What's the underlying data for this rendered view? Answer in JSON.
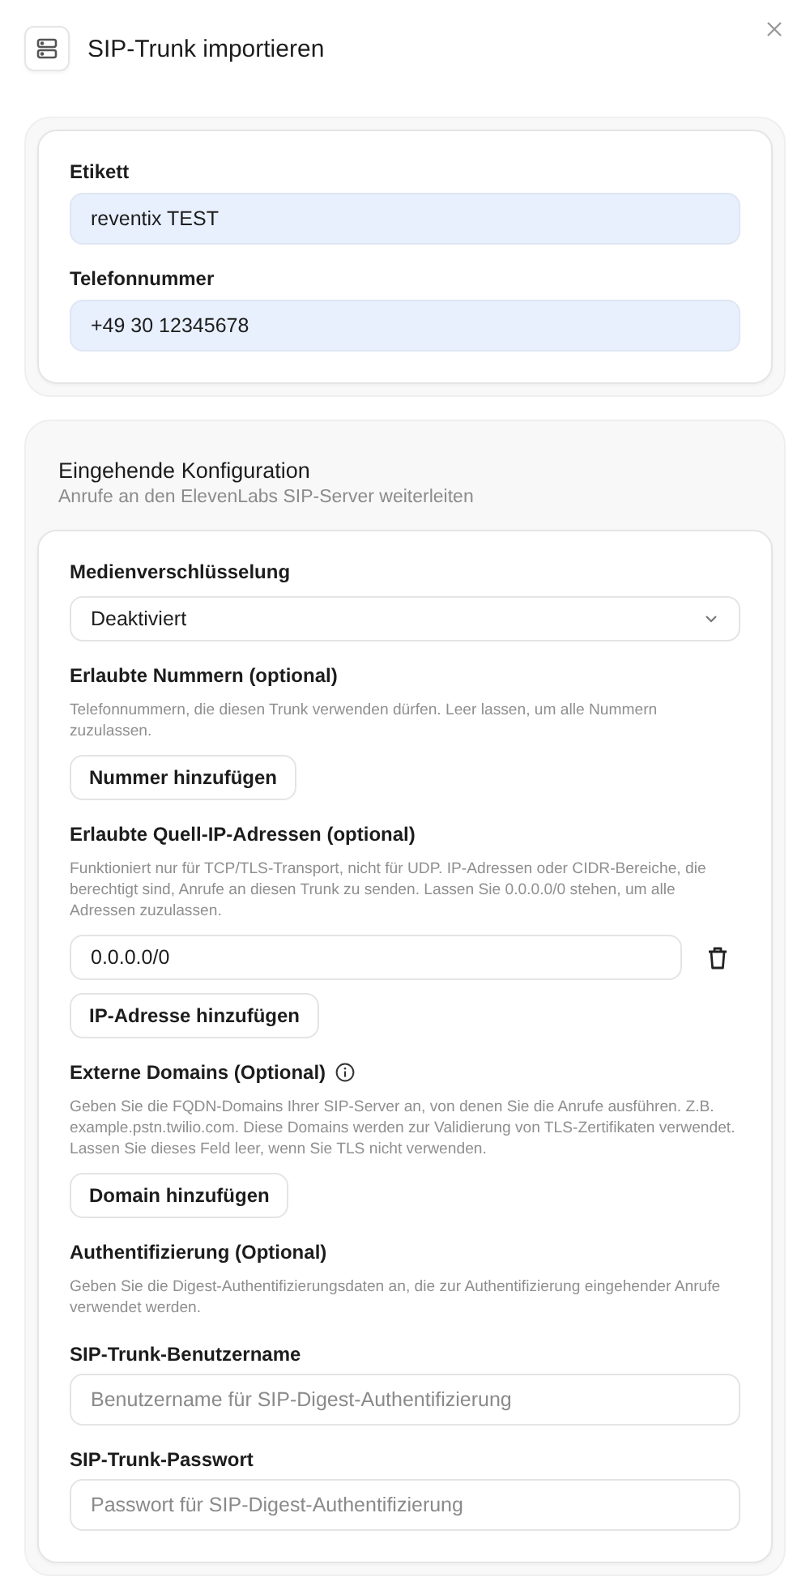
{
  "dialog": {
    "title": "SIP-Trunk importieren"
  },
  "basic_fields": [
    {
      "label": "Etikett",
      "value": "reventix TEST",
      "autofilled": true
    },
    {
      "label": "Telefonnummer",
      "value": "+49 30 12345678",
      "autofilled": true
    }
  ],
  "inbound": {
    "title": "Eingehende Konfiguration",
    "subtitle": "Anrufe an den ElevenLabs SIP-Server weiterleiten",
    "items": [
      {
        "kind": "select",
        "label": "Medienverschlüsselung",
        "value": "Deaktiviert"
      },
      {
        "kind": "group",
        "label": "Erlaubte Nummern (optional)",
        "description": "Telefonnummern, die diesen Trunk verwenden dürfen. Leer lassen, um alle Nummern zuzulassen.",
        "button": "Nummer hinzufügen"
      },
      {
        "kind": "group",
        "label": "Erlaubte Quell-IP-Adressen (optional)",
        "description": "Funktioniert nur für TCP/TLS-Transport, nicht für UDP. IP-Adressen oder CIDR-Bereiche, die berechtigt sind, Anrufe an diesen Trunk zu senden. Lassen Sie 0.0.0.0/0 stehen, um alle Adressen zuzulassen.",
        "entries": [
          "0.0.0.0/0"
        ],
        "button": "IP-Adresse hinzufügen"
      },
      {
        "kind": "group",
        "label": "Externe Domains (Optional)",
        "info": true,
        "description": "Geben Sie die FQDN-Domains Ihrer SIP-Server an, von denen Sie die Anrufe ausführen. Z.B. example.pstn.twilio.com. Diese Domains werden zur Validierung von TLS-Zertifikaten verwendet. Lassen Sie dieses Feld leer, wenn Sie TLS nicht verwenden.",
        "button": "Domain hinzufügen"
      },
      {
        "kind": "heading",
        "label": "Authentifizierung (Optional)",
        "description": "Geben Sie die Digest-Authentifizierungsdaten an, die zur Authentifizierung eingehender Anrufe verwendet werden."
      },
      {
        "kind": "text",
        "label": "SIP-Trunk-Benutzername",
        "placeholder": "Benutzername für SIP-Digest-Authentifizierung"
      },
      {
        "kind": "text",
        "label": "SIP-Trunk-Passwort",
        "placeholder": "Passwort für SIP-Digest-Authentifizierung"
      }
    ]
  }
}
